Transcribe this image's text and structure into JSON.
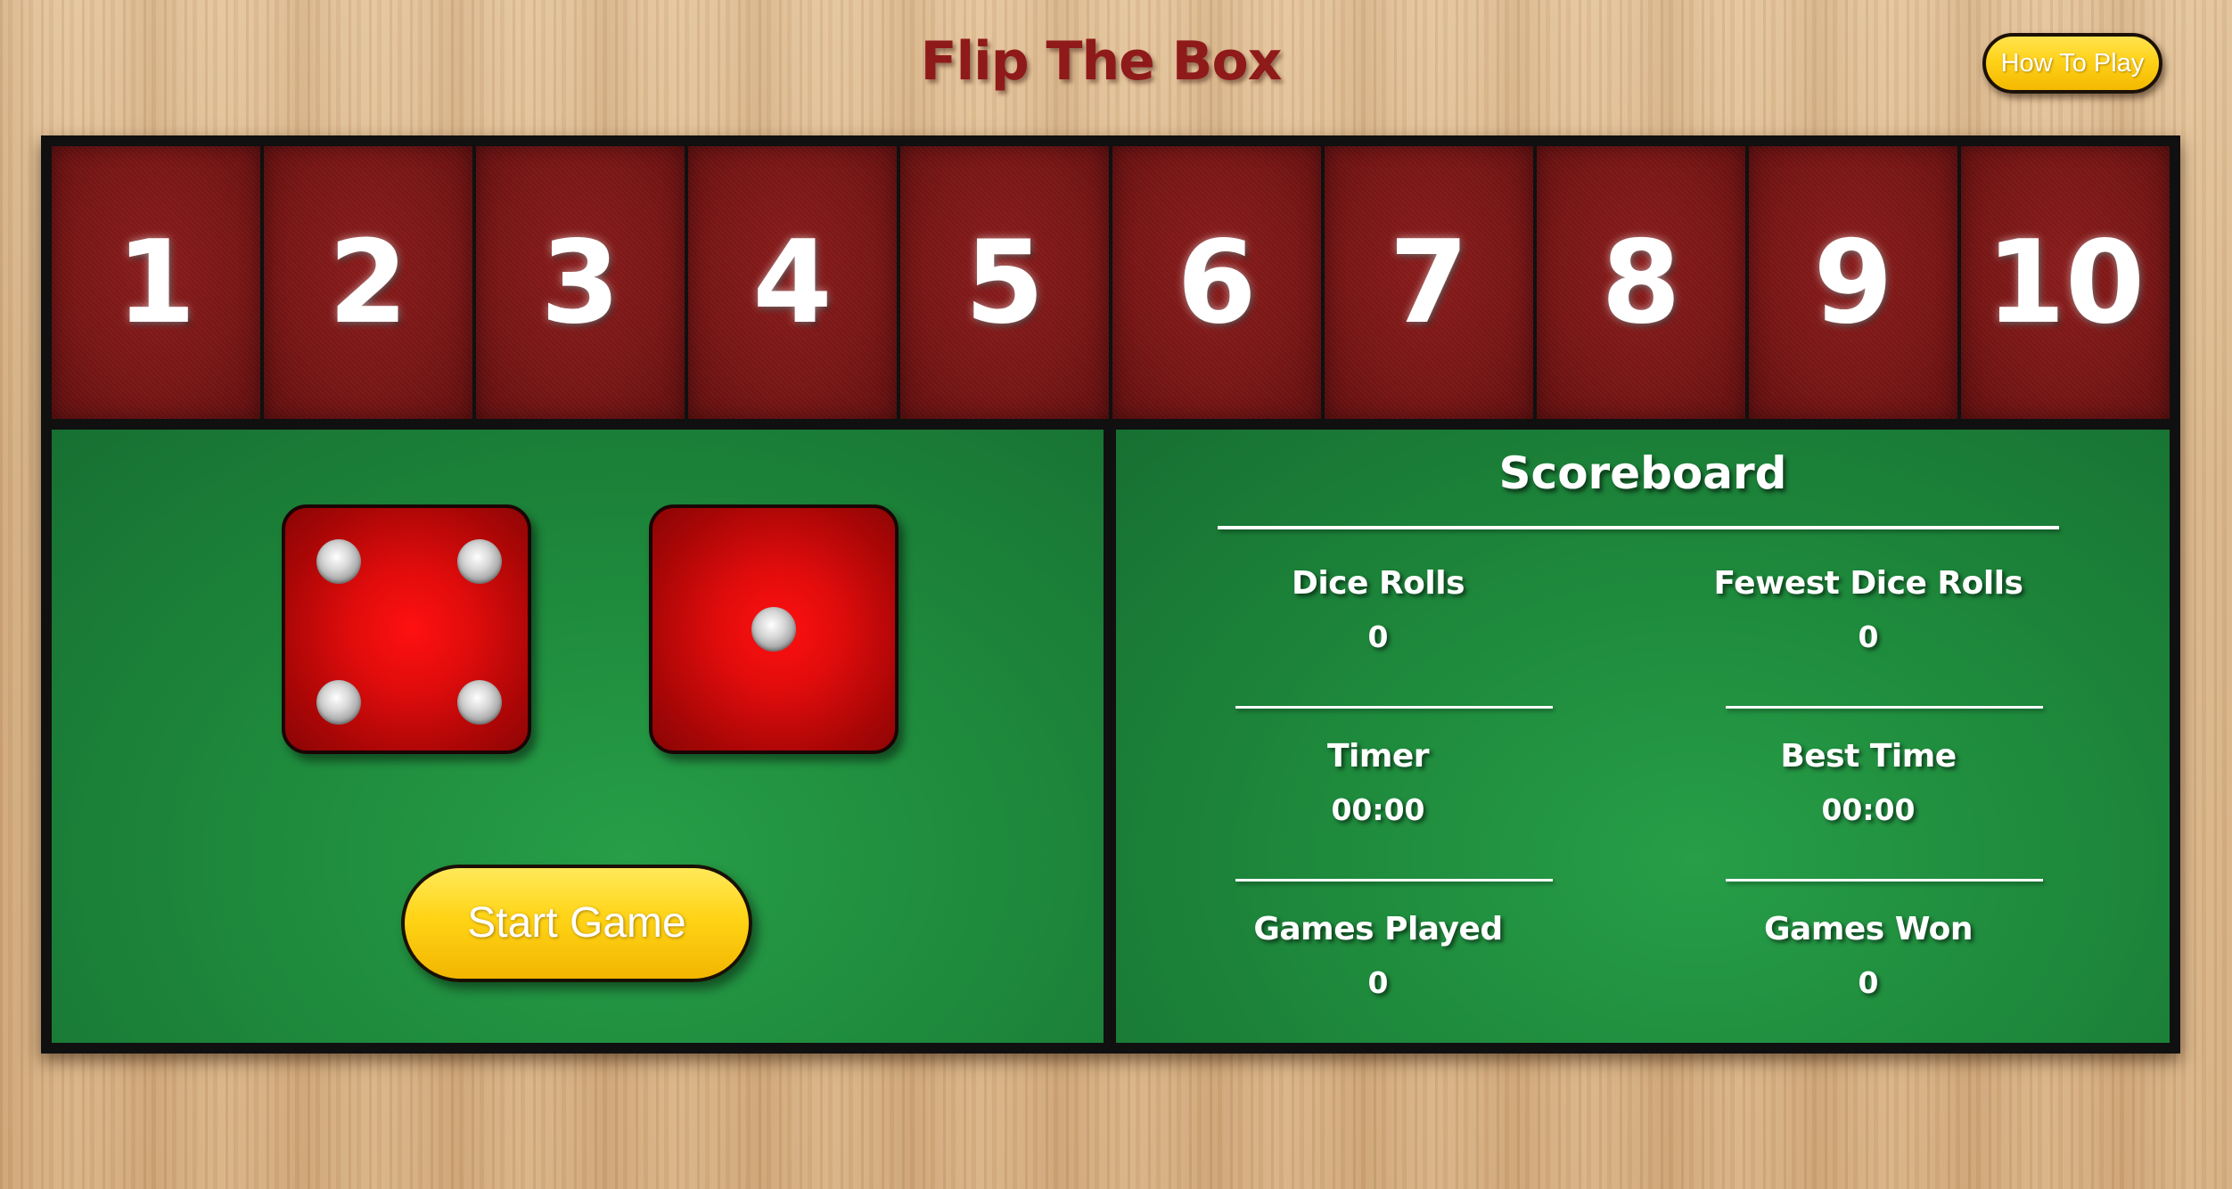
{
  "header": {
    "title": "Flip The Box",
    "how_to_play_label": "How To Play"
  },
  "tiles": [
    "1",
    "2",
    "3",
    "4",
    "5",
    "6",
    "7",
    "8",
    "9",
    "10"
  ],
  "dice": [
    {
      "value": 4
    },
    {
      "value": 1
    }
  ],
  "controls": {
    "start_label": "Start Game"
  },
  "scoreboard": {
    "title": "Scoreboard",
    "stats": {
      "dice_rolls": {
        "label": "Dice Rolls",
        "value": "0"
      },
      "fewest_dice_rolls": {
        "label": "Fewest Dice Rolls",
        "value": "0"
      },
      "timer": {
        "label": "Timer",
        "value": "00:00"
      },
      "best_time": {
        "label": "Best Time",
        "value": "00:00"
      },
      "games_played": {
        "label": "Games Played",
        "value": "0"
      },
      "games_won": {
        "label": "Games Won",
        "value": "0"
      }
    }
  },
  "colors": {
    "title_red": "#8f1a1a",
    "tile_red": "#7a1616",
    "felt_green": "#1e8a3c",
    "die_red": "#e00c0c",
    "button_yellow": "#ffd416"
  }
}
